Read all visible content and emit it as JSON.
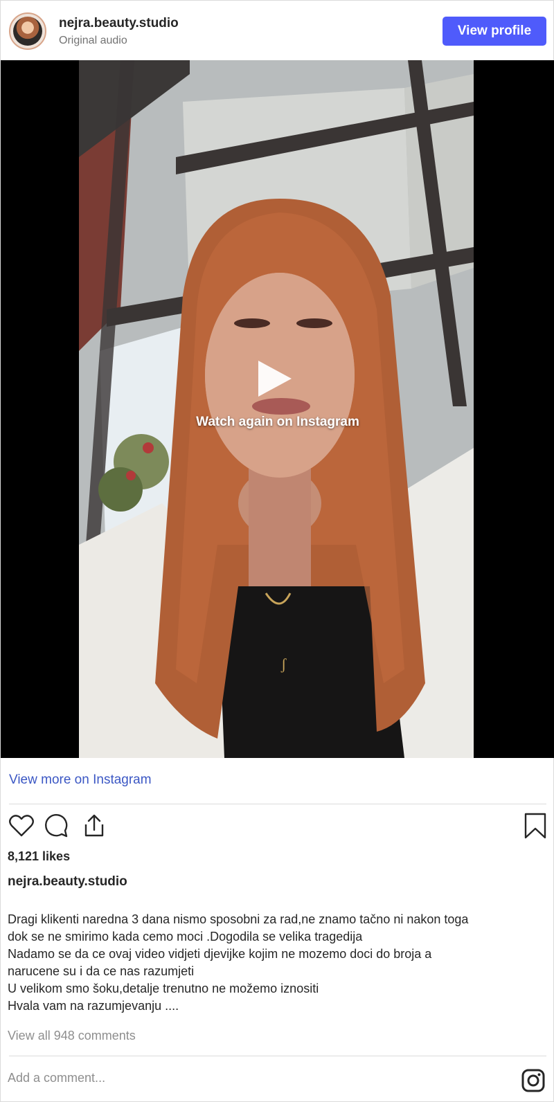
{
  "header": {
    "username": "nejra.beauty.studio",
    "subtitle": "Original audio",
    "view_profile_label": "View profile"
  },
  "video": {
    "overlay_label": "Watch again on Instagram"
  },
  "view_more_label": "View more on Instagram",
  "post": {
    "likes": "8,121 likes",
    "caption_user": "nejra.beauty.studio",
    "caption_lines": [
      "Dragi klikenti naredna 3 dana nismo sposobni za rad,ne znamo tačno ni nakon toga",
      "dok se ne smirimo kada cemo moci .Dogodila se velika tragedija",
      "Nadamo se da ce ovaj video vidjeti djevijke kojim ne mozemo doci do broja a",
      "narucene su i da ce nas razumjeti",
      "U velikom smo šoku,detalje trenutno ne možemo iznositi",
      "Hvala vam na razumjevanju ...."
    ],
    "view_comments": "View all 948 comments",
    "add_comment_placeholder": "Add a comment..."
  },
  "icons": {
    "like": "heart-icon",
    "comment": "comment-icon",
    "share": "share-icon",
    "save": "bookmark-icon",
    "instagram": "instagram-icon"
  },
  "colors": {
    "primary_button": "#4f5bfb",
    "link": "#3b57c4",
    "muted_text": "#8e8e8e"
  }
}
